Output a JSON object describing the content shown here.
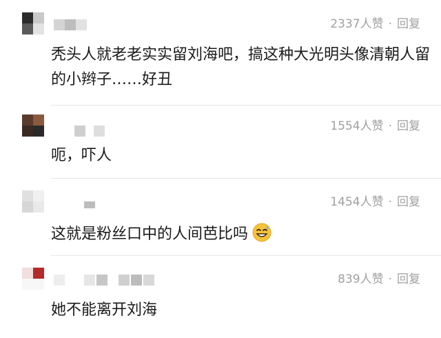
{
  "comments": [
    {
      "likes": "2337人赞",
      "reply": "回复",
      "sep": "·",
      "text": "秃头人就老老实实留刘海吧，搞这种大光明头像清朝人留的小辫子……好丑"
    },
    {
      "likes": "1554人赞",
      "reply": "回复",
      "sep": "·",
      "text": "呃，吓人"
    },
    {
      "likes": "1454人赞",
      "reply": "回复",
      "sep": "·",
      "text": "这就是粉丝口中的人间芭比吗"
    },
    {
      "likes": "839人赞",
      "reply": "回复",
      "sep": "·",
      "text": "她不能离开刘海"
    }
  ],
  "colors": {
    "meta_text": "#a0a0a0",
    "body_text": "#1a1a1a",
    "divider": "#e6e6e6"
  },
  "icons": {
    "emoji": "sweat-smile-emoji-icon"
  }
}
